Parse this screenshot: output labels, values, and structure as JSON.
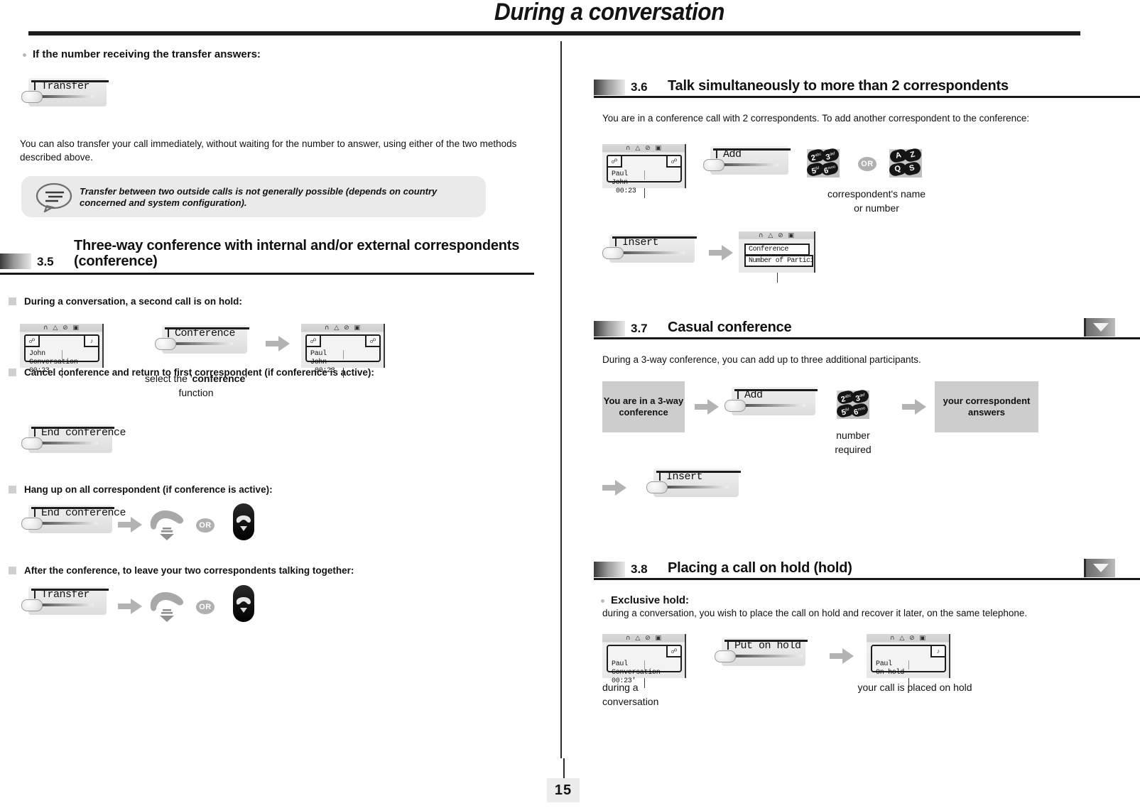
{
  "header": {
    "title": "During a conversation"
  },
  "footer": {
    "page_number": "15"
  },
  "left_column": {
    "bullet_transfer_answers": "If the number receiving the transfer answers:",
    "softkey_transfer": "Transfer",
    "paragraph_transfer": "You can also transfer your call immediately, without waiting for the number to answer, using either of the two methods described above.",
    "note": {
      "icon": "speech-bubble-icon",
      "text": "Transfer between two outside calls is not generally possible (depends on country concerned and system configuration)."
    },
    "section_3_5": {
      "number": "3.5",
      "title_line1": "Three-way conference with internal and/or external correspondents",
      "title_line2": "(conference)"
    },
    "item_second_call_hold": "During a conversation, a second call is on hold:",
    "display_john": {
      "status_icons": "∩ △ ⊘ ▣",
      "tab_left_icon": "handset-icon",
      "tab_right_icon": "hold-icon",
      "line1": "John",
      "line2": "Conversation 00:23"
    },
    "softkey_conference": "Conference",
    "caption_select_conference_1": "select the '",
    "caption_select_conference_bold": "conference",
    "caption_select_conference_2": "'",
    "caption_select_conference_3": "function",
    "display_paul_john": {
      "status_icons": "∩ △ ⊘ ▣",
      "tab_left_icon": "handset-icon",
      "tab_right_icon": "handset-icon",
      "line1": "Paul",
      "line2": "John",
      "line3": "00:23"
    },
    "item_cancel_conference": "Cancel conference and return to first correspondent (if conference is active):",
    "softkey_end_conference_1": "End conference",
    "item_hangup_all": "Hang up on all correspondent (if conference is active):",
    "softkey_end_conference_2": "End conference",
    "or_badge_1": "OR",
    "item_after_conference": "After the conference, to leave your two correspondents talking together:",
    "softkey_transfer_2": "Transfer",
    "or_badge_2": "OR"
  },
  "right_column": {
    "section_3_6": {
      "number": "3.6",
      "title": "Talk simultaneously to more than 2 correspondents"
    },
    "paragraph_3_6": "You are in a conference call with 2 correspondents. To add another correspondent to the conference:",
    "display_paul_john": {
      "status_icons": "∩ △ ⊘ ▣",
      "tab_left_icon": "handset-icon",
      "tab_right_icon": "handset-icon",
      "line1": "Paul",
      "line2": "John",
      "line3": "00:23"
    },
    "softkey_add": "Add",
    "keypad_numeric": {
      "k1": "2",
      "k1sup": "abc",
      "k2": "3",
      "k2sup": "def",
      "k3": "5",
      "k3sup": "jkl",
      "k4": "6",
      "k4sup": "mno"
    },
    "or_badge": "OR",
    "keypad_alpha": {
      "k1": "A",
      "k2": "Z",
      "k3": "Q",
      "k4": "S"
    },
    "caption_correspondent_1": "correspondent's name",
    "caption_correspondent_2": "or number",
    "softkey_insert": "Insert",
    "display_conference": {
      "status_icons": "∩ △ ⊘ ▣",
      "line1": "Conference",
      "line2": "Number of Participants"
    },
    "section_3_7": {
      "number": "3.7",
      "title": "Casual conference"
    },
    "paragraph_3_7": "During a 3-way conference, you can add up to three additional participants.",
    "block_3way": "You are in a 3-way conference",
    "softkey_add_2": "Add",
    "keypad_numeric_2": {
      "k1": "2",
      "k1sup": "abc",
      "k2": "3",
      "k2sup": "def",
      "k3": "5",
      "k3sup": "jkl",
      "k4": "6",
      "k4sup": "mno"
    },
    "caption_number_required_1": "number",
    "caption_number_required_2": "required",
    "block_answers": "your correspondent answers",
    "softkey_insert_2": "Insert",
    "section_3_8": {
      "number": "3.8",
      "title": "Placing a call on hold (hold)"
    },
    "bullet_exclusive_hold": "Exclusive hold:",
    "paragraph_3_8": "during a conversation, you wish to place the call on hold and recover it later, on the same telephone.",
    "display_paul_conversation": {
      "status_icons": "∩ △ ⊘ ▣",
      "tab_right_icon": "handset-icon",
      "line1": "Paul",
      "line2": "Conversation 00:23'"
    },
    "softkey_put_on_hold": "Put on hold",
    "display_paul_on_hold": {
      "status_icons": "∩ △ ⊘ ▣",
      "tab_right_icon": "hold-icon",
      "line1": "Paul",
      "line2": "On hold"
    },
    "caption_during_a_1": "during a",
    "caption_during_a_2": "conversation",
    "caption_placed_on_hold": "your call is placed on hold"
  }
}
